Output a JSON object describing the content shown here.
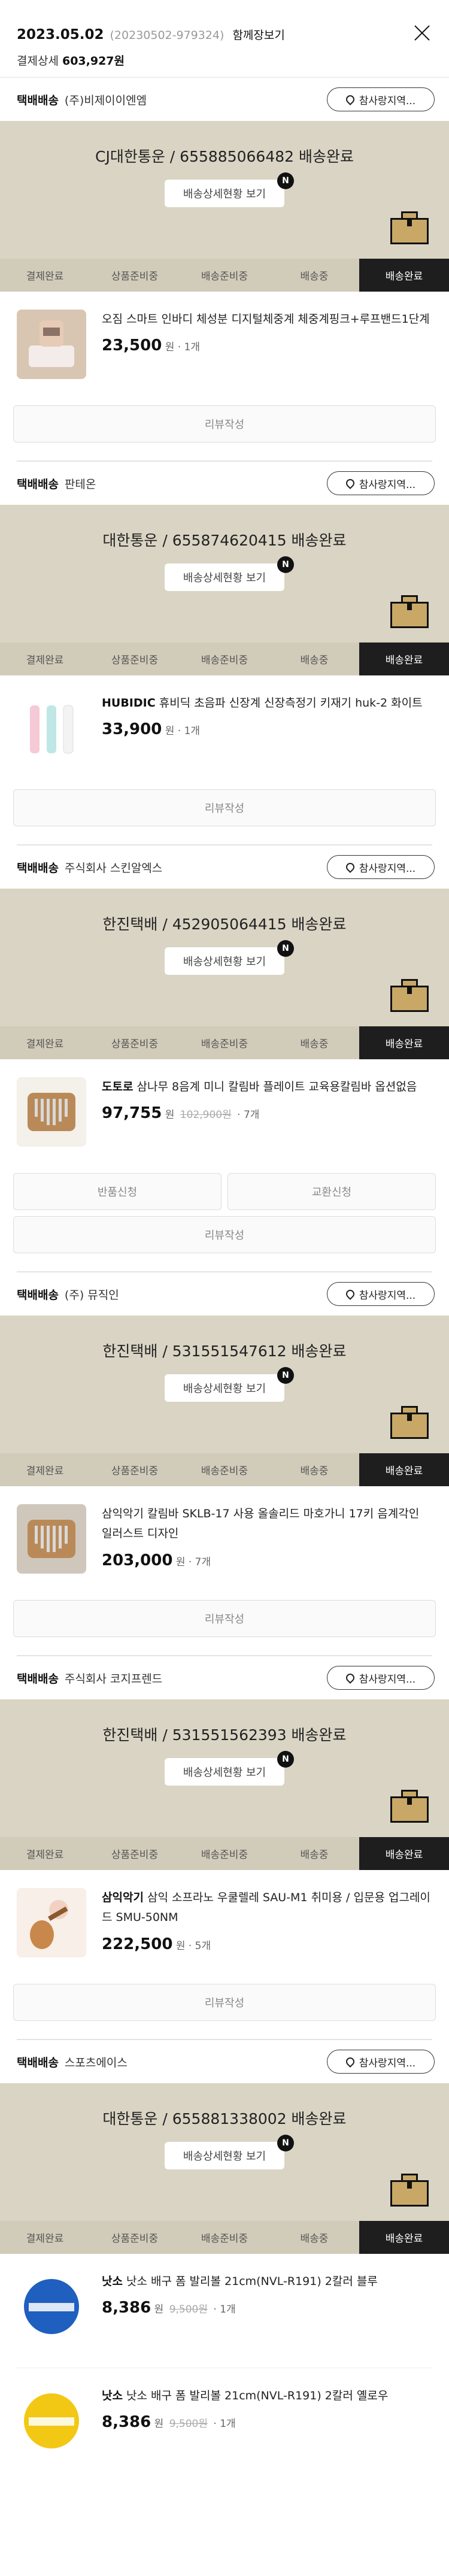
{
  "order": {
    "date": "2023.05.02",
    "number": "(20230502-979324)",
    "view_all": "함께장보기",
    "pay_label": "결제상세",
    "pay_amount": "603,927원"
  },
  "common": {
    "shipping_label": "택배배송",
    "pin_label": "참사랑지역...",
    "tracking_btn": "배송상세현황 보기",
    "new_badge": "N",
    "steps": [
      "결제완료",
      "상품준비중",
      "배송준비중",
      "배송중",
      "배송완료"
    ],
    "review_btn": "리뷰작성",
    "return_btn": "반품신청",
    "exchange_btn": "교환신청"
  },
  "sections": [
    {
      "seller": "(주)비제이이엔엠",
      "tracking": "CJ대한통운 / 655885066482 배송완료",
      "products": [
        {
          "brand": "",
          "name": "오짐 스마트 인바디 체성분 디지털체중계 체중계핑크+루프밴드1단계",
          "price": "23,500",
          "unit": "원",
          "orig": "",
          "qty": "· 1개"
        }
      ]
    },
    {
      "seller": "판테온",
      "tracking": "대한통운 / 655874620415 배송완료",
      "products": [
        {
          "brand": "HUBIDIC",
          "name": "휴비딕 초음파 신장계 신장측정기 키재기 huk-2 화이트",
          "price": "33,900",
          "unit": "원",
          "orig": "",
          "qty": "· 1개"
        }
      ]
    },
    {
      "seller": "주식회사 스킨알엑스",
      "tracking": "한진택배 / 452905064415 배송완료",
      "products": [
        {
          "brand": "도토로",
          "name": "삼나무 8음계 미니 칼림바 플레이트 교육용칼림바 옵션없음",
          "price": "97,755",
          "unit": "원",
          "orig": "102,900원",
          "qty": "· 7개"
        }
      ]
    },
    {
      "seller": "(주) 뮤직인",
      "tracking": "한진택배 / 531551547612 배송완료",
      "products": [
        {
          "brand": "",
          "name": "삼익악기 칼림바 SKLB-17 사용 올솔리드 마호가니 17키 음계각인 일러스트 디자인",
          "price": "203,000",
          "unit": "원",
          "orig": "",
          "qty": "· 7개"
        }
      ]
    },
    {
      "seller": "주식회사 코지프렌드",
      "tracking": "한진택배 / 531551562393 배송완료",
      "products": [
        {
          "brand": "삼익악기",
          "name": "삼익 소프라노 우쿨렐레 SAU-M1 취미용 / 입문용 업그레이드 SMU-50NM",
          "price": "222,500",
          "unit": "원",
          "orig": "",
          "qty": "· 5개"
        }
      ]
    },
    {
      "seller": "스포츠에이스",
      "tracking": "대한통운 / 655881338002 배송완료",
      "products": [
        {
          "brand": "낫소",
          "name": "낫소 배구 폼 발리볼 21cm(NVL-R191) 2칼러 블루",
          "price": "8,386",
          "unit": "원",
          "orig": "9,500원",
          "qty": "· 1개"
        },
        {
          "brand": "낫소",
          "name": "낫소 배구 폼 발리볼 21cm(NVL-R191) 2칼러 옐로우",
          "price": "8,386",
          "unit": "원",
          "orig": "9,500원",
          "qty": "· 1개"
        }
      ]
    }
  ],
  "colors": {
    "tracking_bg": "#dad4c4",
    "steps_bg": "#d1cbb9",
    "active_step": "#1e1e1e",
    "box": "#c9a867"
  }
}
